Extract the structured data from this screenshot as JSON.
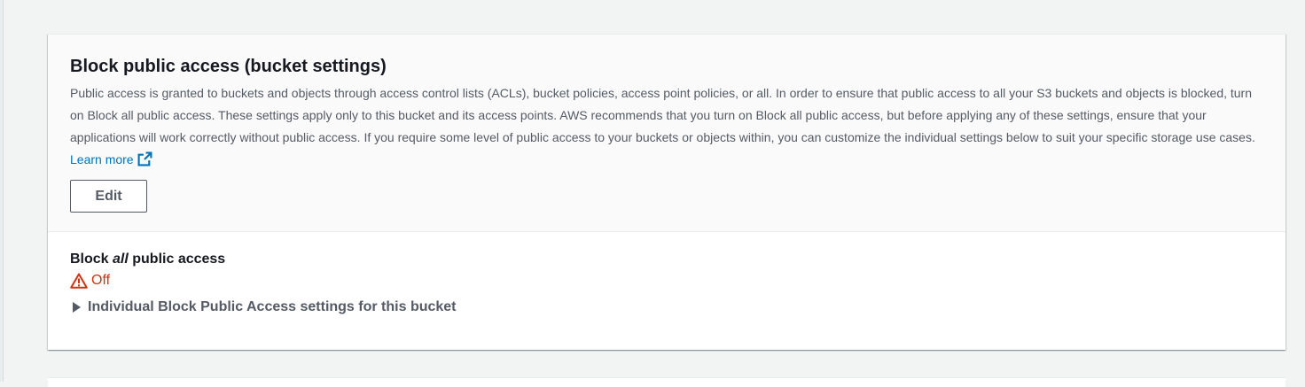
{
  "section": {
    "title": "Block public access (bucket settings)",
    "description": "Public access is granted to buckets and objects through access control lists (ACLs), bucket policies, access point policies, or all. In order to ensure that public access to all your S3 buckets and objects is blocked, turn on Block all public access. These settings apply only to this bucket and its access points. AWS recommends that you turn on Block all public access, but before applying any of these settings, ensure that your applications will work correctly without public access. If you require some level of public access to your buckets or objects within, you can customize the individual settings below to suit your specific storage use cases.",
    "learn_more": "Learn more",
    "edit_label": "Edit"
  },
  "setting": {
    "label_prefix": "Block ",
    "label_emphasis": "all",
    "label_suffix": " public access",
    "status": "Off",
    "status_color": "#d13212",
    "status_icon": "warning-icon"
  },
  "expander": {
    "label": "Individual Block Public Access settings for this bucket",
    "icon": "caret-right-icon"
  },
  "colors": {
    "link": "#0073bb",
    "text_secondary": "#545b64"
  }
}
